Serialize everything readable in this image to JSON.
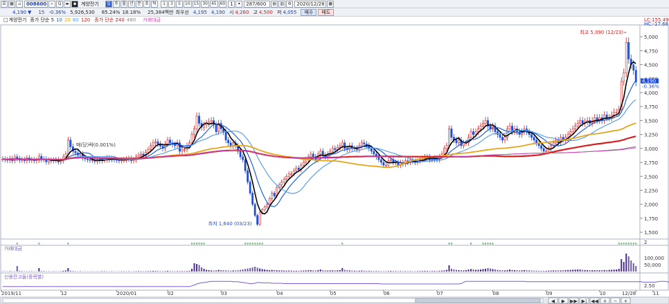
{
  "toolbar1": {
    "stock_code": "008600",
    "stock_name": "계양전기",
    "periods": [
      "주",
      "월",
      "년",
      "분",
      "초",
      "틱"
    ],
    "minute_steps": [
      "1",
      "3",
      "5",
      "10",
      "15",
      "30",
      "45",
      "60"
    ],
    "sep": "1",
    "count": "287/600",
    "date": "2020/12/28",
    "buy_label": "매수",
    "sell_label": "매도"
  },
  "toolbar2": {
    "price": "4,190",
    "price_icon": "down-triangle-icon",
    "diff_prefix": "15",
    "diff": "-0.36%",
    "volume": "5,926,530",
    "pct1": "85.24%",
    "pct2": "18.18%",
    "amount": "25,384백만",
    "hoga_label": "최우선",
    "bid": "4,195",
    "ask": "4,190",
    "open_label": "시",
    "open": "4,260",
    "high_label": "고",
    "high": "4,500",
    "low_label": "저",
    "low": "4,055"
  },
  "legend": {
    "checkbox": "□",
    "stock": "계양전기",
    "ma_price": "종가 단순 5",
    "ma_price_nums": [
      "10",
      "20",
      "60",
      "120"
    ],
    "ma_vol": "종가 단순 240",
    "ma_vol_num": "480",
    "vol_legend": "거래대금"
  },
  "chart_data": [
    {
      "type": "line",
      "title": "",
      "subplot": "price",
      "y_axis_ticks": [
        "5,000",
        "4,750",
        "4,500",
        "4,250",
        "4,000",
        "3,750",
        "3,500",
        "3,250",
        "3,000",
        "2,750",
        "2,500",
        "2,250",
        "2,000",
        "1,750",
        "1,500"
      ],
      "ylim": [
        1390,
        5200
      ],
      "top_labels": [
        "LC:155.49",
        "HC:-17.68"
      ],
      "last_price_label": "4,190",
      "last_pct_label": "-0.36%",
      "annotations": {
        "high": "최고 5,090 (12/23)",
        "low": "최저 1,640 (03/23)",
        "event": "매(당)락(0.001%)"
      },
      "x_labels": [
        "2019/11",
        "12",
        "2020/01",
        "02",
        "03",
        "04",
        "05",
        "06",
        "07",
        "08",
        "09",
        "10",
        "11",
        "12",
        "12/28"
      ],
      "series": [
        {
          "role": "close",
          "color": "#c42121",
          "values": [
            2810,
            2800,
            2790,
            2820,
            2780,
            2850,
            2820,
            2790,
            2800,
            2780,
            2830,
            2790,
            2800,
            2780,
            2790,
            2860,
            2800,
            2810,
            2760,
            2790,
            2780,
            2790,
            2800,
            2760,
            2780,
            2850,
            2900,
            3150,
            3030,
            2950,
            2920,
            2880,
            2900,
            2830,
            2810,
            2800,
            2790,
            2790,
            2770,
            2800,
            2780,
            2790,
            2800,
            2830,
            2800,
            2820,
            2800,
            2790,
            2780,
            2790,
            2800,
            2810,
            2820,
            2780,
            2800,
            2850,
            2880,
            2900,
            2870,
            2930,
            2980,
            3050,
            3100,
            3120,
            3080,
            3040,
            3000,
            3080,
            3150,
            3100,
            3070,
            3050,
            3100,
            2950,
            2980,
            2980,
            3050,
            3100,
            3250,
            3350,
            3580,
            3450,
            3380,
            3420,
            3450,
            3480,
            3500,
            3420,
            3300,
            3450,
            3350,
            3300,
            3150,
            3100,
            3050,
            3100,
            3050,
            2950,
            2850,
            2800,
            2600,
            2400,
            2200,
            2000,
            1800,
            1640,
            1850,
            1900,
            1950,
            2000,
            2100,
            2200,
            2150,
            2300,
            2350,
            2400,
            2450,
            2500,
            2550,
            2550,
            2600,
            2650,
            2620,
            2700,
            2750,
            2800,
            2850,
            2900,
            2850,
            2800,
            2900,
            2950,
            2880,
            2850,
            2900,
            2950,
            3000,
            2980,
            3020,
            3050,
            3100,
            3000,
            2980,
            3050,
            3000,
            3000,
            2980,
            3050,
            3100,
            3080,
            3050,
            3000,
            2950,
            2900,
            2850,
            2800,
            2750,
            2700,
            2700,
            2780,
            2800,
            2750,
            2750,
            2700,
            2750,
            2720,
            2780,
            2750,
            2800,
            2770,
            2750,
            2780,
            2800,
            2820,
            2850,
            2850,
            2800,
            2800,
            2830,
            2800,
            2850,
            2900,
            3000,
            3050,
            3350,
            3200,
            3150,
            3100,
            3150,
            3050,
            3100,
            3100,
            3200,
            3300,
            3250,
            3300,
            3350,
            3400,
            3450,
            3500,
            3400,
            3350,
            3400,
            3300,
            3250,
            3200,
            3150,
            3200,
            3350,
            3400,
            3300,
            3350,
            3300,
            3250,
            3300,
            3350,
            3300,
            3250,
            3200,
            3150,
            3100,
            3050,
            3000,
            2950,
            2950,
            3000,
            3050,
            3100,
            3150,
            3100,
            3200,
            3150,
            3200,
            3250,
            3300,
            3350,
            3400,
            3450,
            3500,
            3450,
            3480,
            3500,
            3450,
            3500,
            3550,
            3500,
            3550,
            3500,
            3600,
            3550,
            3550,
            3600,
            3650,
            3650,
            3700,
            4200,
            4350,
            4900,
            4600,
            4500,
            4400,
            4190
          ]
        },
        {
          "role": "ma5",
          "color": "#000000"
        },
        {
          "role": "ma10",
          "color": "#1f5fd9"
        },
        {
          "role": "ma20",
          "color": "#59a0e8"
        },
        {
          "role": "ma60",
          "color": "#e8a318"
        },
        {
          "role": "ma120",
          "color": "#d41f1f"
        },
        {
          "role": "ma240",
          "color": "#8a8a8a"
        },
        {
          "role": "ma480",
          "color": "#d23eb5"
        }
      ]
    },
    {
      "type": "bar",
      "subplot": "volume",
      "title": "거래대금",
      "y_axis_ticks": [
        "100,000",
        "50,000"
      ],
      "ylim": [
        0,
        145000
      ],
      "values": [
        2000,
        2500,
        2000,
        3000,
        2500,
        2000,
        40000,
        5000,
        3000,
        2500,
        2000,
        3000,
        2500,
        2000,
        2000,
        25000,
        4000,
        3000,
        2500,
        2000,
        2000,
        2500,
        2000,
        2000,
        2500,
        5000,
        8000,
        25000,
        6000,
        4000,
        3000,
        2500,
        2500,
        2000,
        2000,
        2000,
        2500,
        2000,
        2000,
        2000,
        2500,
        3000,
        2500,
        2000,
        2000,
        2500,
        2000,
        2000,
        2000,
        2500,
        2000,
        2000,
        2500,
        2000,
        2000,
        3000,
        3500,
        3000,
        2500,
        3000,
        3500,
        4000,
        5000,
        4500,
        4000,
        3500,
        3000,
        3500,
        5000,
        4000,
        3500,
        3000,
        3500,
        4000,
        3500,
        3000,
        4000,
        5000,
        20000,
        60000,
        55000,
        48000,
        30000,
        20000,
        12000,
        10000,
        8000,
        7000,
        9000,
        12000,
        10000,
        9000,
        8000,
        7000,
        6000,
        8000,
        7000,
        9000,
        12000,
        15000,
        18000,
        22000,
        25000,
        30000,
        35000,
        28000,
        22000,
        18000,
        15000,
        12000,
        10000,
        12000,
        10000,
        9000,
        8000,
        8000,
        7000,
        6000,
        7000,
        6000,
        5000,
        6000,
        5000,
        6000,
        7000,
        8000,
        9000,
        10000,
        8000,
        7000,
        10000,
        15000,
        9000,
        8000,
        7000,
        8000,
        9000,
        8000,
        9000,
        10000,
        25000,
        12000,
        9000,
        8000,
        7000,
        6000,
        5000,
        6000,
        7000,
        6000,
        5000,
        6000,
        5000,
        4000,
        5000,
        4000,
        3500,
        3000,
        3000,
        4000,
        5000,
        4000,
        3500,
        3000,
        3500,
        3000,
        3500,
        3000,
        3500,
        3000,
        3000,
        3500,
        4000,
        4500,
        5000,
        4500,
        4000,
        4000,
        4500,
        4000,
        5000,
        6000,
        8000,
        12000,
        45000,
        20000,
        15000,
        12000,
        10000,
        9000,
        8000,
        10000,
        15000,
        18000,
        15000,
        12000,
        13000,
        15000,
        18000,
        20000,
        25000,
        22000,
        18000,
        15000,
        12000,
        10000,
        9000,
        8000,
        10000,
        15000,
        12000,
        10000,
        9000,
        8000,
        9000,
        10000,
        9000,
        8000,
        7000,
        6000,
        6000,
        5000,
        5000,
        5000,
        5000,
        6000,
        7000,
        8000,
        7000,
        8000,
        8000,
        9000,
        10000,
        11000,
        12000,
        13000,
        14000,
        15000,
        14000,
        12000,
        11000,
        10000,
        9000,
        10000,
        9000,
        10000,
        9000,
        10000,
        11000,
        10000,
        12000,
        13000,
        14000,
        15000,
        20000,
        90000,
        70000,
        130000,
        110000,
        80000,
        60000,
        40000
      ]
    },
    {
      "type": "line",
      "subplot": "credit",
      "title": "신용잔고율(종목별)",
      "y_axis_ticks": [
        "2.50"
      ],
      "ylim": [
        1.6,
        4.4
      ],
      "values": [
        2.2,
        2.2,
        2.2,
        2.2,
        2.2,
        2.2,
        2.2,
        2.2,
        2.2,
        2.2,
        2.25,
        2.2,
        2.2,
        2.2,
        2.2,
        2.2,
        2.2,
        2.2,
        2.2,
        2.2,
        2.2,
        2.2,
        2.2,
        2.2,
        2.2,
        2.2,
        2.2,
        2.2,
        2.2,
        2.2,
        2.2,
        2.2,
        2.2,
        2.2,
        2.2,
        2.2,
        2.2,
        2.2,
        2.2,
        2.2,
        2.2,
        2.2,
        2.2,
        2.2,
        2.2,
        2.2,
        2.2,
        2.2,
        2.2,
        2.2,
        2.2,
        2.2,
        2.2,
        2.2,
        2.2,
        2.2,
        2.2,
        2.2,
        2.2,
        2.2,
        2.2,
        2.2,
        2.2,
        2.2,
        2.2,
        2.2,
        2.2,
        2.2,
        2.2,
        2.2,
        2.2,
        2.2,
        2.2,
        2.2,
        2.2,
        2.2,
        2.2,
        2.2,
        2.4,
        2.6,
        2.9,
        3.1,
        3.2,
        3.3,
        3.4,
        3.5,
        3.6,
        3.6,
        3.6,
        3.6,
        3.6,
        3.6,
        3.6,
        3.6,
        3.6,
        3.5,
        3.5,
        3.5,
        3.4,
        3.3,
        3.2,
        3.1,
        3.0,
        3.0,
        3.1,
        3.3,
        3.3,
        3.2,
        3.2,
        3.2,
        3.2,
        3.1,
        3.1,
        3.1,
        3.1,
        3.1,
        3.0,
        3.0,
        3.0,
        3.0,
        3.0,
        3.0,
        3.0,
        3.0,
        3.0,
        3.0,
        3.0,
        3.0,
        3.0,
        3.0,
        3.0,
        3.0,
        3.0,
        3.0,
        3.0,
        3.0,
        3.0,
        3.0,
        3.0,
        3.0,
        3.0,
        3.0,
        3.0,
        3.0,
        3.0,
        3.0,
        3.0,
        3.0,
        3.0,
        3.0,
        3.0,
        3.0,
        3.0,
        3.0,
        3.0,
        3.0,
        2.9,
        2.9,
        2.9,
        2.9,
        2.9,
        2.9,
        2.9,
        2.9,
        2.9,
        2.9,
        2.9,
        2.9,
        2.9,
        2.9,
        2.9,
        2.9,
        2.9,
        2.9,
        2.9,
        2.9,
        2.9,
        2.9,
        2.9,
        2.9,
        2.9,
        2.9,
        2.9,
        2.9,
        2.9,
        2.9,
        2.9,
        2.9,
        2.9,
        3.0,
        3.4,
        3.6,
        3.6,
        3.6,
        3.6,
        3.6,
        3.6,
        3.6,
        3.6,
        3.6,
        3.6,
        3.6,
        3.6,
        3.6,
        3.6,
        3.6,
        3.6,
        3.6,
        3.6,
        3.6,
        3.6,
        3.6,
        3.6,
        3.6,
        3.6,
        3.6,
        3.5,
        3.5,
        3.5,
        3.5,
        3.5,
        3.5,
        3.5,
        3.5,
        3.5,
        3.5,
        3.5,
        3.5,
        3.5,
        3.5,
        3.5,
        3.5,
        3.5,
        3.5,
        3.5,
        3.5,
        3.5,
        3.5,
        3.5,
        3.5,
        3.5,
        3.5,
        3.5,
        3.5,
        3.5,
        3.5,
        3.5,
        3.5,
        3.5,
        3.5,
        3.5,
        3.5,
        3.5,
        3.5,
        3.5,
        3.5,
        3.5,
        3.5,
        3.5,
        3.5,
        3.5,
        3.5,
        3.5,
        3.5,
        3.4,
        3.4,
        3.4,
        3.4,
        3.4,
        3.4,
        3.5,
        3.6,
        3.6,
        3.6,
        3.5,
        3.3,
        2.6,
        2.5
      ]
    }
  ],
  "status": {
    "nav_buttons": [
      "◀",
      "▶",
      "▶▶",
      "▶|",
      "◀◀",
      "+",
      "−",
      "+"
    ]
  }
}
